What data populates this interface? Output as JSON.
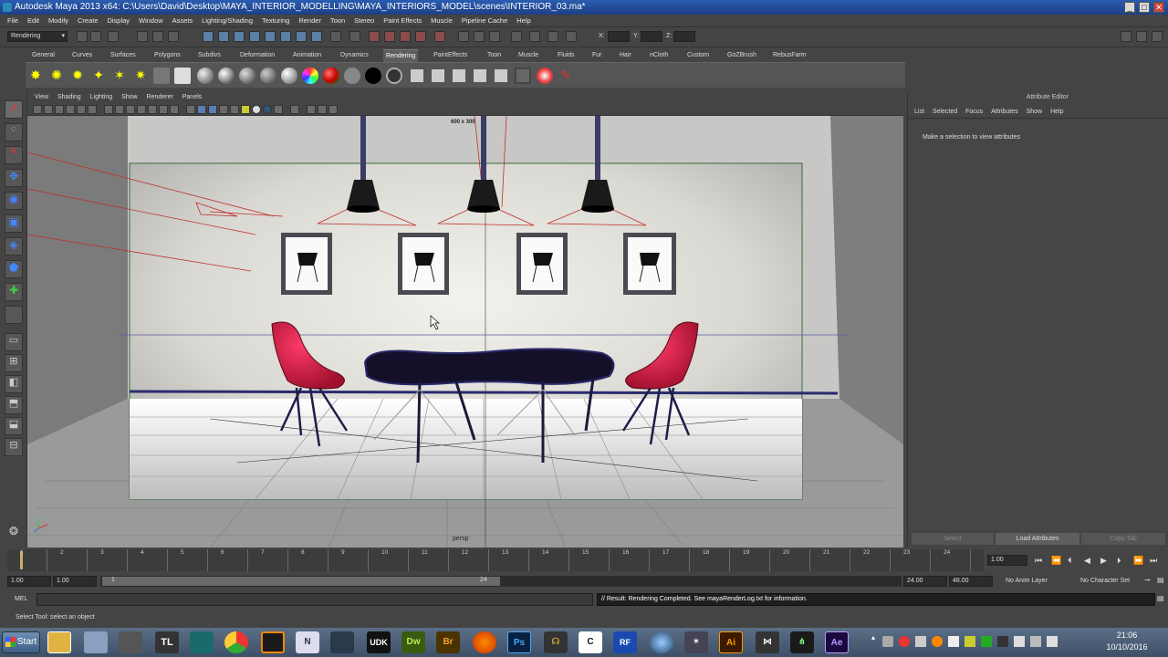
{
  "window": {
    "title": "Autodesk Maya 2013 x64: C:\\Users\\David\\Desktop\\MAYA_INTERIOR_MODELLING\\MAYA_INTERIORS_MODEL\\scenes\\INTERIOR_03.ma*",
    "min": "_",
    "max": "□",
    "close": "✕"
  },
  "menubar": [
    "File",
    "Edit",
    "Modify",
    "Create",
    "Display",
    "Window",
    "Assets",
    "Lighting/Shading",
    "Texturing",
    "Render",
    "Toon",
    "Stereo",
    "Paint Effects",
    "Muscle",
    "Pipeline Cache",
    "Help"
  ],
  "statusline": {
    "mode": "Rendering",
    "x_label": "X:",
    "y_label": "Y:",
    "z_label": "Z:"
  },
  "shelf_tabs": [
    "General",
    "Curves",
    "Surfaces",
    "Polygons",
    "Subdivs",
    "Deformation",
    "Animation",
    "Dynamics",
    "Rendering",
    "PaintEffects",
    "Toon",
    "Muscle",
    "Fluids",
    "Fur",
    "Hair",
    "nCloth",
    "Custom",
    "GoZBrush",
    "RebusFarm"
  ],
  "shelf_active": "Rendering",
  "viewport": {
    "menu": [
      "View",
      "Shading",
      "Lighting",
      "Show",
      "Renderer",
      "Panels"
    ],
    "resolution": "600 x 300",
    "camera": "persp"
  },
  "attribute_editor": {
    "title": "Attribute Editor",
    "menu": [
      "List",
      "Selected",
      "Focus",
      "Attributes",
      "Show",
      "Help"
    ],
    "message": "Make a selection to view attributes",
    "select_btn": "Select",
    "load_btn": "Load Attributes",
    "copy_btn": "Copy Tab"
  },
  "timeline": {
    "ticks": [
      "1",
      "2",
      "3",
      "4",
      "5",
      "6",
      "7",
      "8",
      "9",
      "10",
      "11",
      "12",
      "13",
      "14",
      "15",
      "16",
      "17",
      "18",
      "19",
      "20",
      "21",
      "22",
      "23",
      "24"
    ],
    "current": "1.00"
  },
  "range": {
    "start": "1.00",
    "start2": "1.00",
    "slider_min": "1",
    "slider_max": "24",
    "end": "24.00",
    "end2": "48.00",
    "anim_layer": "No Anim Layer",
    "char_set": "No Character Set"
  },
  "command": {
    "label": "MEL",
    "result": "// Result: Rendering Completed. See mayaRenderLog.txt for information."
  },
  "helpline": "Select Tool: select an object",
  "taskbar": {
    "start": "Start",
    "apps": [
      "Explorer",
      "Tools",
      "Inkscape",
      "TL",
      "Maya",
      "Chrome",
      "FL",
      "N",
      "Unity",
      "UDK",
      "Dw",
      "Br",
      "Firefox",
      "Ps",
      "Headphones",
      "C",
      "RF",
      "Settings",
      "Anim",
      "Ai",
      "VS",
      "Animator",
      "Ae"
    ],
    "time": "21:06",
    "date": "10/10/2016"
  }
}
